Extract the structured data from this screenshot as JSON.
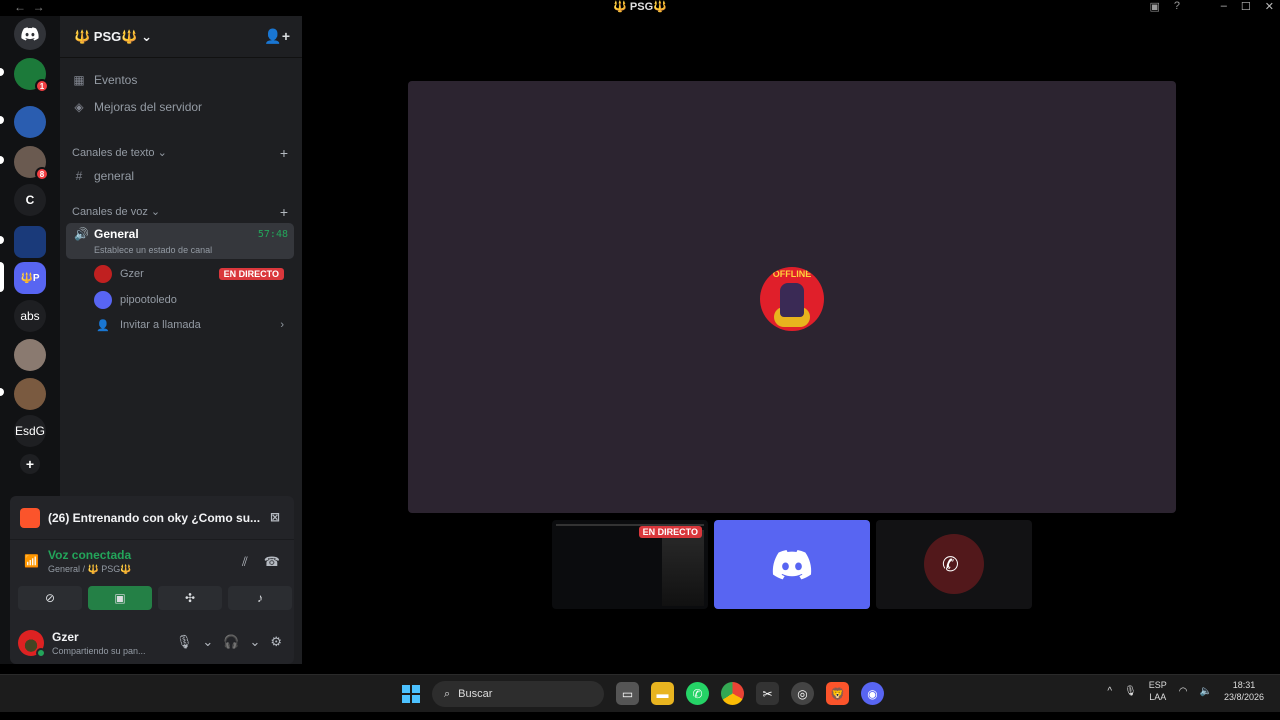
{
  "window": {
    "title": "🔱 PSG🔱",
    "nav_back": "←",
    "nav_forward": "→",
    "controls": [
      "–",
      "☐",
      "✕"
    ]
  },
  "servers": [
    {
      "label": "",
      "icon": "discord-home-icon"
    },
    {
      "label": "",
      "badge": "1"
    },
    {
      "label": ""
    },
    {
      "label": "",
      "badge": "8"
    },
    {
      "label": "C"
    },
    {
      "label": ""
    },
    {
      "label": "🔱P"
    },
    {
      "label": "abs"
    },
    {
      "label": ""
    },
    {
      "label": ""
    },
    {
      "label": "EsdG"
    },
    {
      "label": "+",
      "icon": "add-server-icon"
    }
  ],
  "guild": {
    "name": "🔱 PSG🔱",
    "items": [
      {
        "label": "Eventos",
        "icon": "calendar-icon"
      },
      {
        "label": "Mejoras del servidor",
        "icon": "boost-icon"
      }
    ],
    "text_category": "Canales de texto",
    "text_channels": [
      {
        "label": "general"
      }
    ],
    "voice_category": "Canales de voz",
    "voice_channel": {
      "name": "General",
      "status": "Establece un estado de canal",
      "timer": "57:48",
      "users": [
        {
          "name": "Gzer",
          "live": "EN DIRECTO"
        },
        {
          "name": "pipootoledo"
        }
      ],
      "invite": "Invitar a llamada"
    }
  },
  "panel": {
    "stream_title": "(26) Entrenando con oky ¿Como su...",
    "voice_status": "Voz conectada",
    "voice_location": "General / 🔱 PSG🔱",
    "user": {
      "name": "Gzer",
      "status": "Compartiendo su pan..."
    }
  },
  "stage": {
    "avatar_text": "OFFLINE",
    "live_badge": "EN DIRECTO"
  },
  "taskbar": {
    "search": "Buscar",
    "lang_top": "ESP",
    "lang_bottom": "LAA",
    "time": "18:31",
    "date": "23/8/2026"
  }
}
